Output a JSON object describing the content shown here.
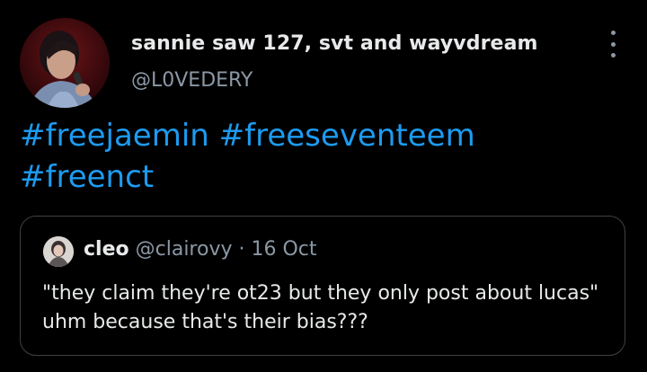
{
  "tweet": {
    "display_name": "sannie saw 127, svt and wayvdream",
    "handle": "@L0VEDERY",
    "hashtags": [
      "#freejaemin",
      "#freeseventeem",
      "#freenct"
    ]
  },
  "quote": {
    "name": "cleo",
    "handle": "@clairovy",
    "separator": "·",
    "date": "16 Oct",
    "text": "\"they claim they're ot23 but they only post about lucas\" uhm because that's their bias???"
  },
  "icons": {
    "more": "more-vertical-icon"
  },
  "colors": {
    "background": "#000000",
    "text": "#e7e9ea",
    "muted": "#8b98a5",
    "link": "#1d9bf0",
    "border": "#3e4144"
  }
}
